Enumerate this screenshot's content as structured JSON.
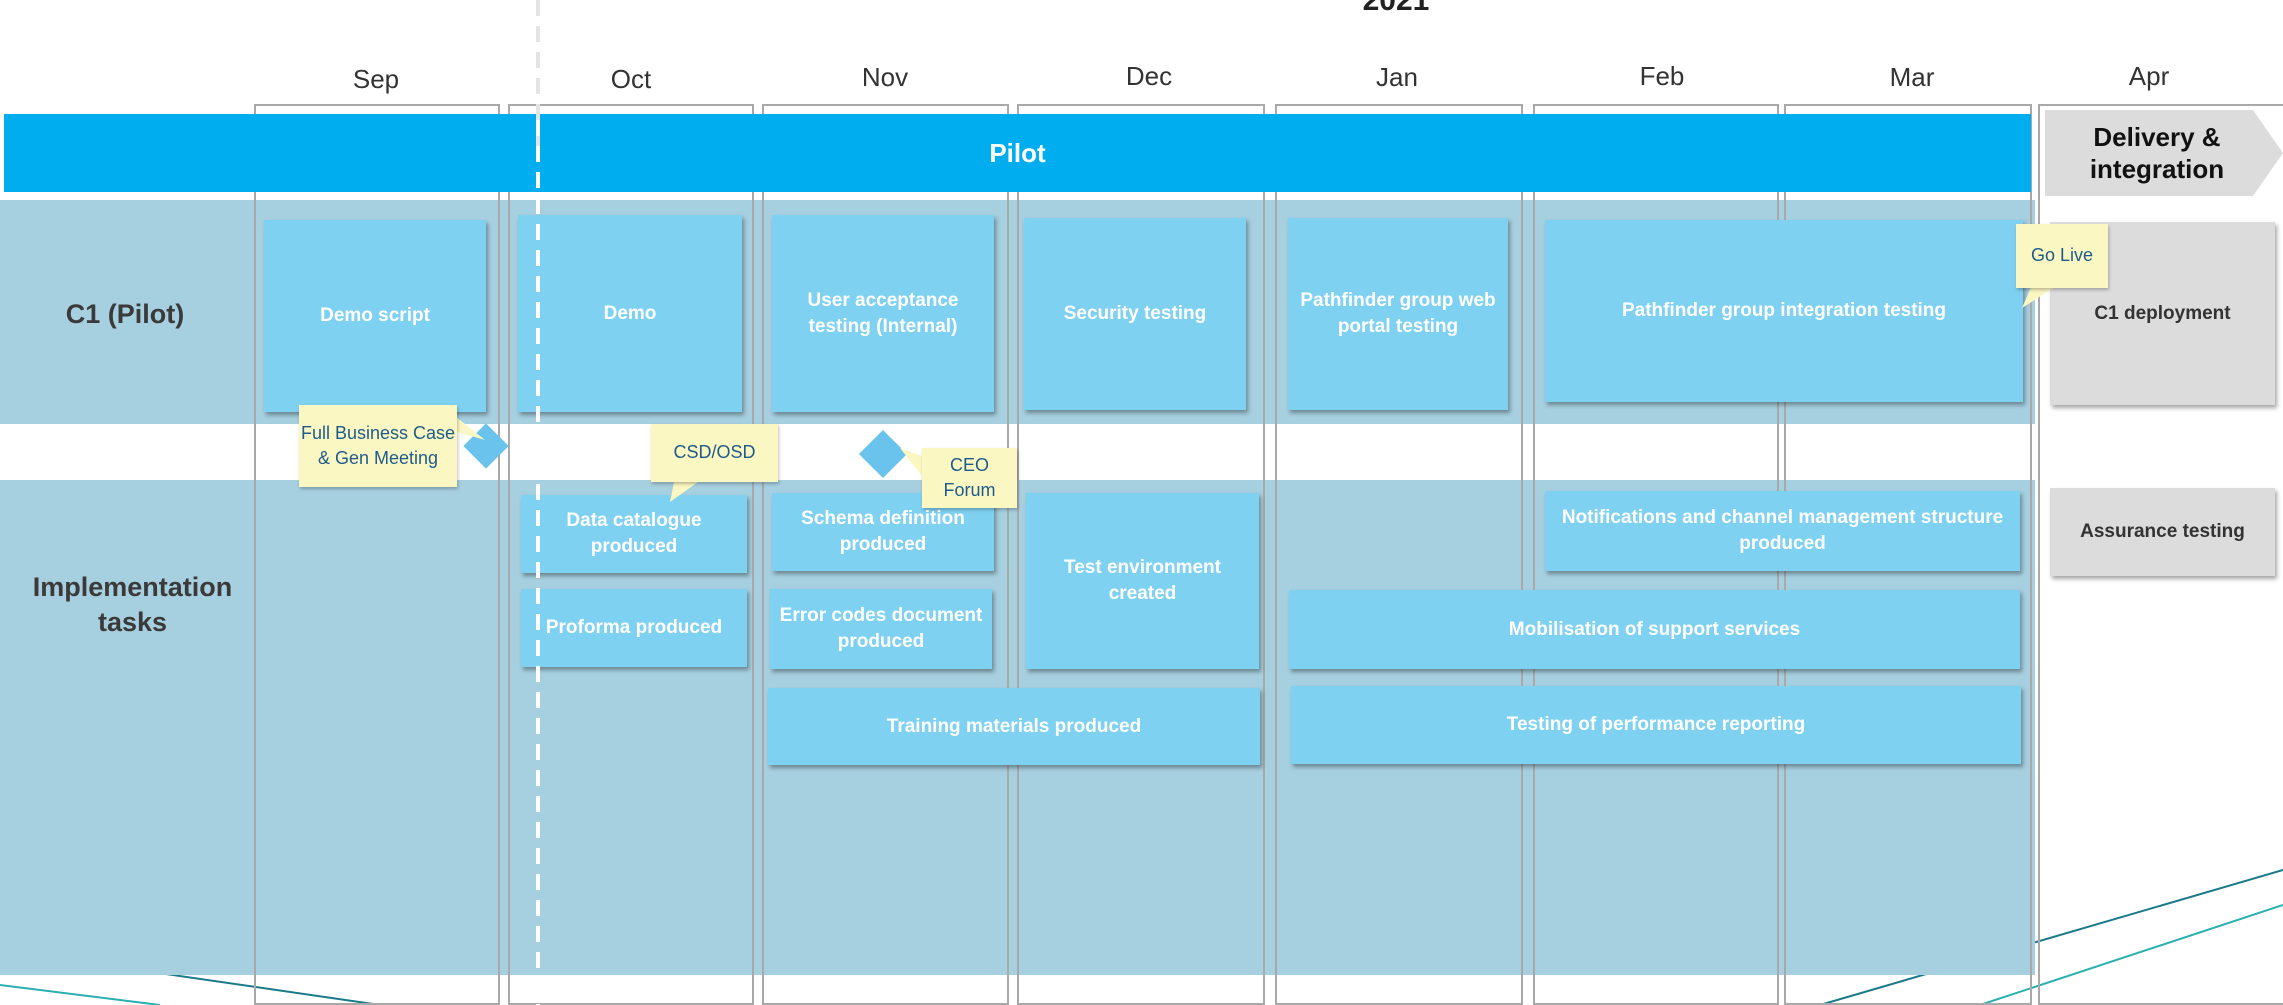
{
  "year": "2021",
  "months": [
    "Sep",
    "Oct",
    "Nov",
    "Dec",
    "Jan",
    "Feb",
    "Mar",
    "Apr"
  ],
  "phases": {
    "pilot": "Pilot",
    "delivery": "Delivery & integration"
  },
  "rows": {
    "c1_pilot": "C1 (Pilot)",
    "implementation": "Implementation tasks"
  },
  "c1_tasks": {
    "demo_script": "Demo script",
    "demo": "Demo",
    "uat": "User acceptance testing (Internal)",
    "security": "Security testing",
    "pathfinder_portal": "Pathfinder group web portal testing",
    "pathfinder_integration": "Pathfinder group integration testing",
    "c1_deployment": "C1 deployment"
  },
  "impl_tasks": {
    "data_catalogue": "Data catalogue produced",
    "proforma": "Proforma produced",
    "schema": "Schema definition produced",
    "error_codes": "Error codes document produced",
    "test_env": "Test environment created",
    "training": "Training materials produced",
    "notifications": "Notifications and channel management structure produced",
    "mobilisation": "Mobilisation of support services",
    "perf_reporting": "Testing of performance reporting",
    "assurance": "Assurance testing"
  },
  "milestones": {
    "full_business_case": "Full Business Case & Gen Meeting",
    "csd_osd": "CSD/OSD",
    "ceo_forum": "CEO Forum",
    "go_live": "Go Live"
  },
  "colors": {
    "pilot_bar": "#00adef",
    "task_box": "#7fd1f1",
    "row_band": "#a6cfdf",
    "callout": "#fbf7c2",
    "callout_text": "#1e5b8c",
    "delivery_box": "#dcdcdc"
  }
}
